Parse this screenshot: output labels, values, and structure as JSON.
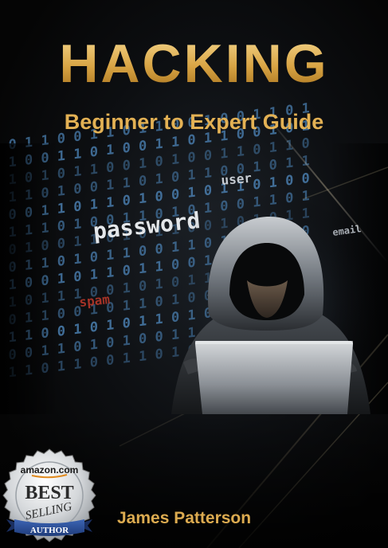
{
  "cover": {
    "title": "HACKING",
    "subtitle": "Beginner to Expert Guide",
    "author": "James Patterson",
    "background_words": [
      "user",
      "password",
      "email",
      "spam"
    ],
    "binary_rows": [
      "1 0 1 1 0 0 1 1 0 1 1 0 0 1 0 0 1 1 0 1",
      "0 1 0 0 1 1 0 1 0 0 1 1 0 1 1 0 0 1 0 1",
      "1 1 0 1 0 1 1 0 0 1 0 1 0 0 1 1 0 1 1 0",
      "0 1 1 0 1 0 0 1 1 0 1 0 1 1 0 0 1 0 1 1",
      "1 0 0 1 1 0 1 1 0 1 0 0 1 0 1 1 0 1 0 0",
      "0 1 1 1 0 1 0 0 1 1 0 1 0 1 0 0 1 1 0 1",
      "1 0 1 0 0 1 1 0 1 0 1 1 0 0 1 0 1 0 1 1",
      "0 0 1 1 0 1 0 1 1 0 0 1 1 0 1 1 0 0 1 0",
      "1 1 0 0 1 0 1 1 0 1 1 0 0 1 0 1 1 0 1 0",
      "0 1 0 1 1 1 0 0 1 0 1 0 1 1 0 0 1 1 0 1",
      "1 0 1 1 0 0 1 0 1 1 0 1 0 0 1 1 0 1 0 1",
      "0 1 1 0 0 1 0 1 0 1 1 0 1 0 1 0 0 1 1 0",
      "1 0 0 1 1 0 1 0 1 0 0 1 1 0 1 1 0 0 1 1",
      "0 1 1 0 1 1 0 0 1 1 0 1 0 1 0 1 1 0 0 1"
    ],
    "colors": {
      "gold": "#d9a84a",
      "background": "#07080a",
      "binary_blue": "#4a7fb0",
      "spam_red": "#c0392b"
    }
  },
  "badge": {
    "brand": "amazon.com",
    "line1": "BEST",
    "line2": "SELLING",
    "ribbon": "AUTHOR"
  }
}
